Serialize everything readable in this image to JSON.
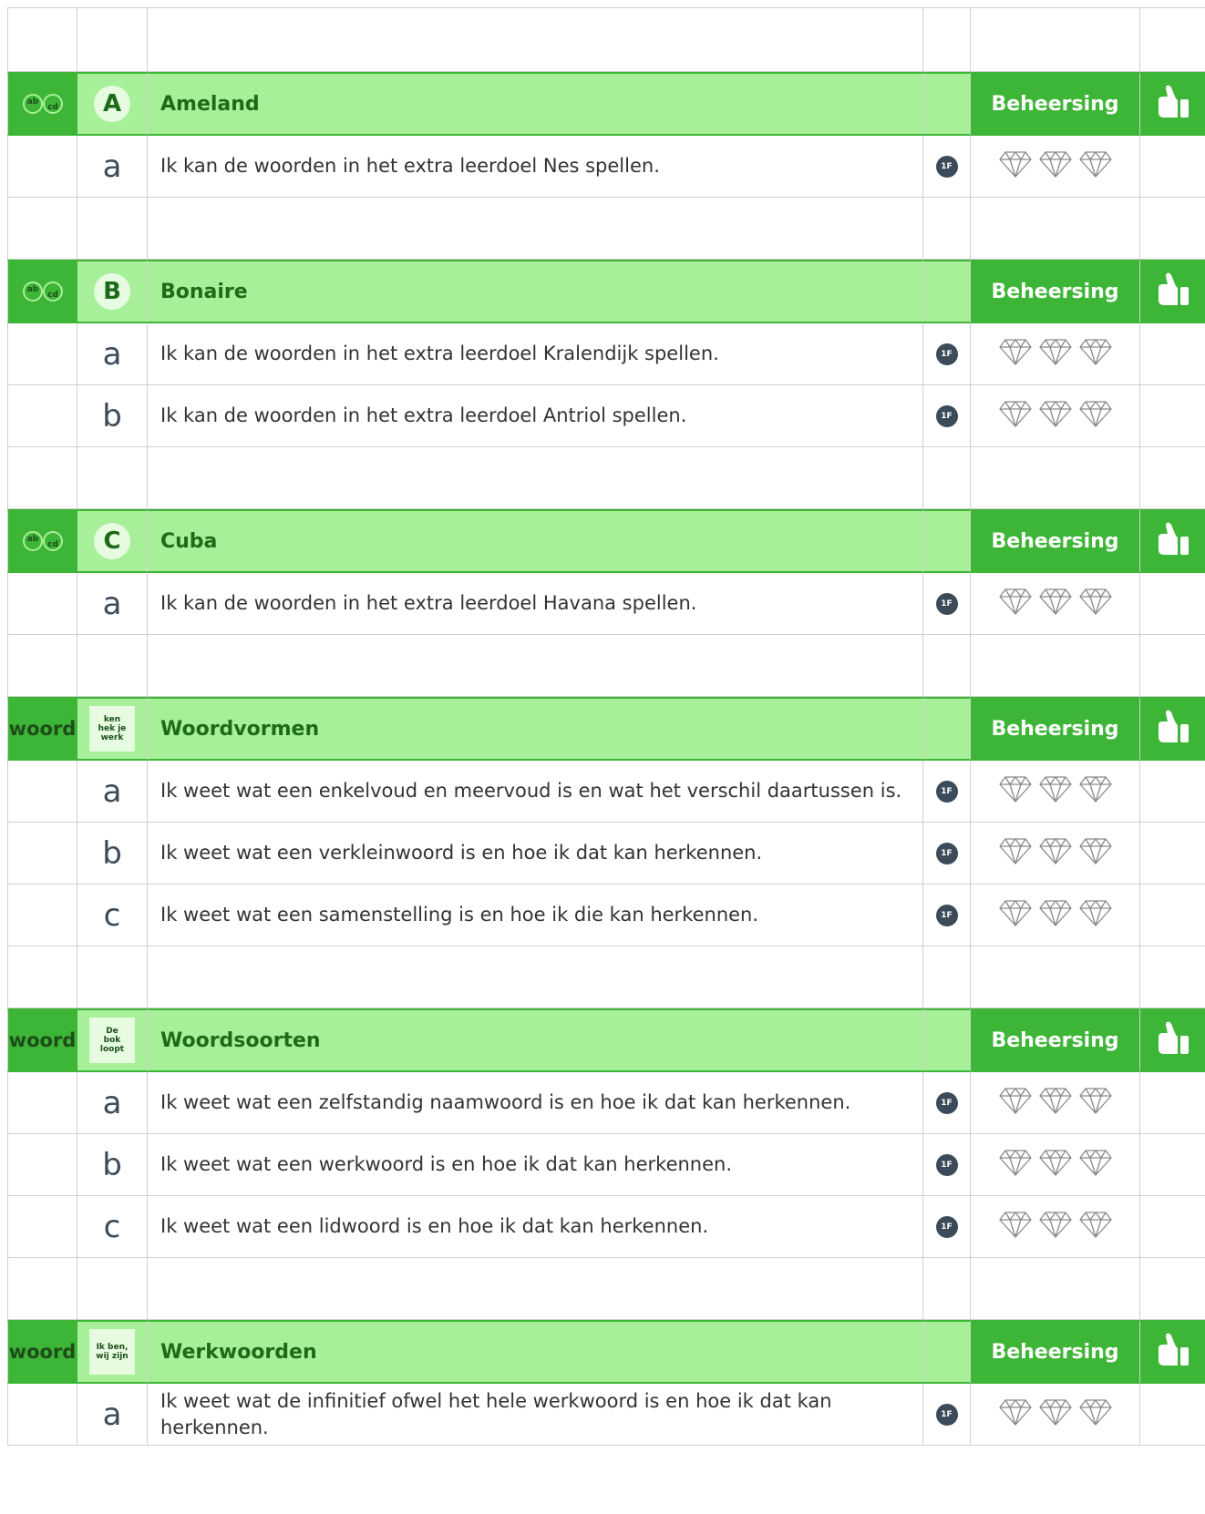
{
  "sections": [
    {
      "type_label": "",
      "badge": "A",
      "badge_kind": "letter",
      "title": "Ameland",
      "status_label": "Beheersing",
      "goals": [
        {
          "letter": "a",
          "text": "Ik kan de woorden in het extra leerdoel Nes spellen.",
          "level": "1F"
        }
      ]
    },
    {
      "type_label": "",
      "badge": "B",
      "badge_kind": "letter",
      "title": "Bonaire",
      "status_label": "Beheersing",
      "goals": [
        {
          "letter": "a",
          "text": "Ik kan de woorden in het extra leerdoel Kralendijk spellen.",
          "level": "1F"
        },
        {
          "letter": "b",
          "text": "Ik kan de woorden in het extra leerdoel Antriol spellen.",
          "level": "1F"
        }
      ]
    },
    {
      "type_label": "",
      "badge": "C",
      "badge_kind": "letter",
      "title": "Cuba",
      "status_label": "Beheersing",
      "goals": [
        {
          "letter": "a",
          "text": "Ik kan de woorden in het extra leerdoel Havana spellen.",
          "level": "1F"
        }
      ]
    },
    {
      "type_label": "woord",
      "badge": "ken\nhek je\nwerk",
      "badge_kind": "mini",
      "title": "Woordvormen",
      "status_label": "Beheersing",
      "goals": [
        {
          "letter": "a",
          "text": "Ik weet wat een enkelvoud en meervoud is en wat het verschil daartussen is.",
          "level": "1F"
        },
        {
          "letter": "b",
          "text": "Ik weet wat een verkleinwoord is en hoe ik dat kan herkennen.",
          "level": "1F"
        },
        {
          "letter": "c",
          "text": "Ik weet wat een samenstelling is en hoe ik die kan herkennen.",
          "level": "1F"
        }
      ]
    },
    {
      "type_label": "woord",
      "badge": "De\nbok\nloopt",
      "badge_kind": "mini",
      "title": "Woordsoorten",
      "status_label": "Beheersing",
      "goals": [
        {
          "letter": "a",
          "text": "Ik weet wat een zelfstandig naamwoord is en hoe ik dat kan herkennen.",
          "level": "1F"
        },
        {
          "letter": "b",
          "text": "Ik weet wat een werkwoord is en hoe ik dat kan herkennen.",
          "level": "1F"
        },
        {
          "letter": "c",
          "text": "Ik weet wat een lidwoord is en hoe ik dat kan herkennen.",
          "level": "1F"
        }
      ]
    },
    {
      "type_label": "woord",
      "badge": "Ik ben,\nwij zijn",
      "badge_kind": "mini",
      "title": "Werkwoorden",
      "status_label": "Beheersing",
      "goals": [
        {
          "letter": "a",
          "text": "Ik weet wat de infinitief ofwel het hele werkwoord is en hoe ik dat kan herkennen.",
          "level": "1F"
        }
      ]
    }
  ],
  "icons": {
    "ab_icon": "ab-cd-swap-icon",
    "gem_icon": "diamond-icon",
    "thumb_icon": "thumbs-up-icon",
    "gems_per_goal": 3
  },
  "colors": {
    "header_dark_green": "#3db536",
    "header_light_green": "#a8ef99",
    "title_green": "#1d6b1a",
    "level_badge": "#3c4b5a",
    "grid_line": "#d0d0d0"
  }
}
